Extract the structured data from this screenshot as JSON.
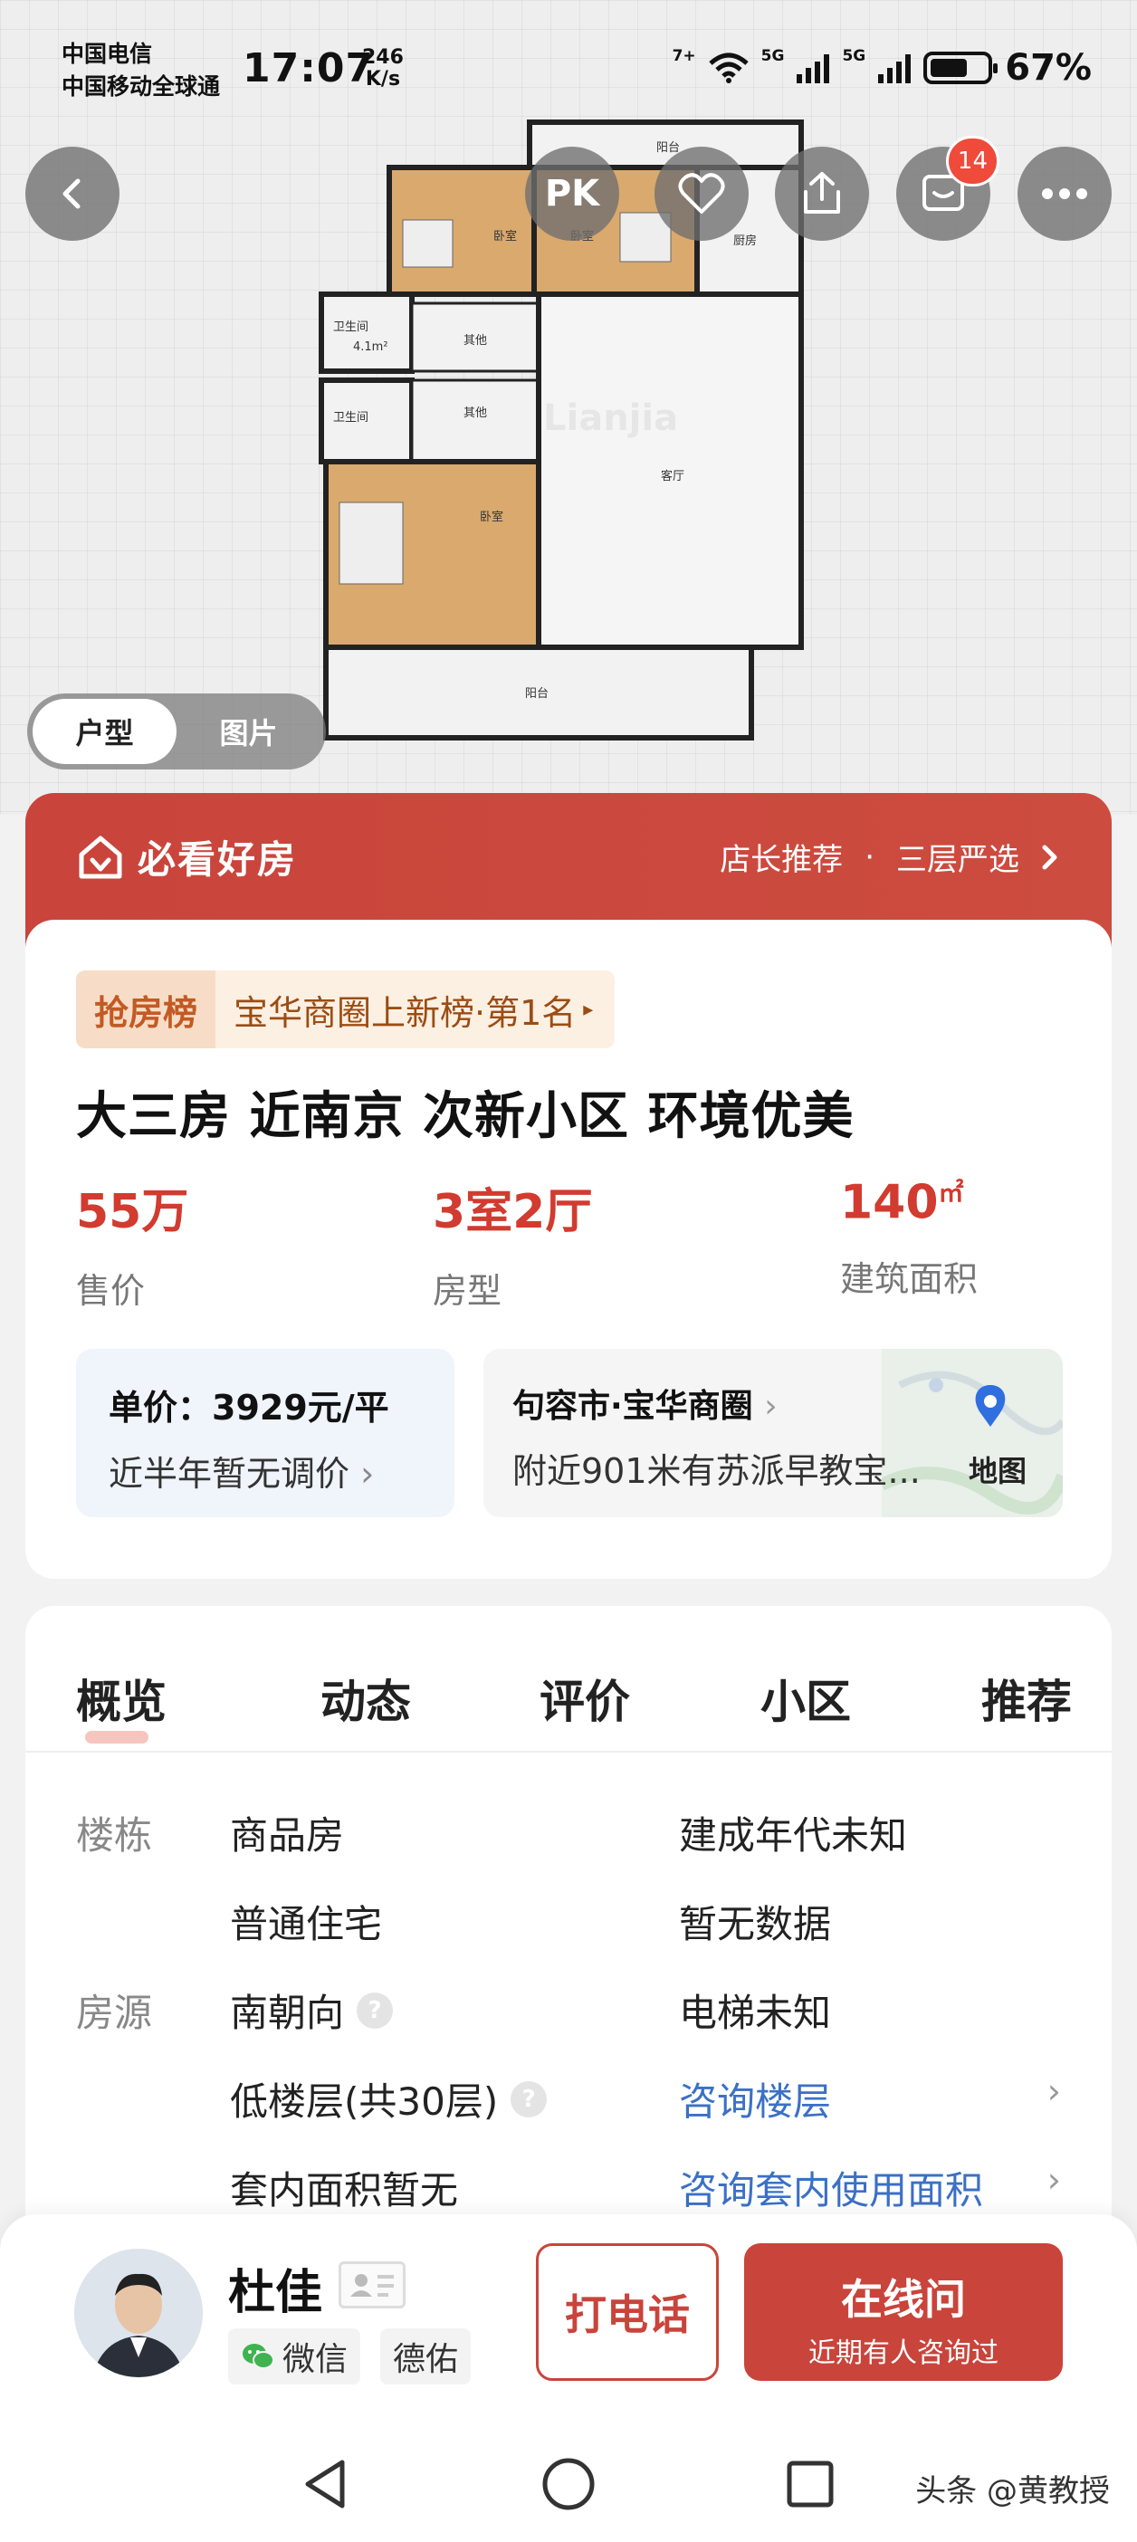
{
  "status": {
    "carrier1": "中国电信",
    "carrier2": "中国移动全球通",
    "time": "17:07",
    "netspeed_value": "246",
    "netspeed_unit": "K/s",
    "wifi_label": "7+",
    "sig1_label": "5G",
    "sig2_label": "5G",
    "battery_pct": "67%",
    "battery_level": 0.67
  },
  "header": {
    "pk_label": "PK",
    "message_badge": "14"
  },
  "floorplan": {
    "rooms": {
      "balcony_top": "阳台",
      "bedroom1": "卧室",
      "bedroom2": "卧室",
      "kitchen": "厨房",
      "bath1": "卫生间",
      "bath1_area": "4.1m²",
      "other1": "其他",
      "bath2": "卫生间",
      "other2": "其他",
      "living": "客厅",
      "bedroom3": "卧室",
      "balcony_bottom": "阳台"
    }
  },
  "view_toggle": {
    "options": [
      "户型",
      "图片"
    ],
    "active": "户型"
  },
  "banner": {
    "brand": "必看好房",
    "item1": "店长推荐",
    "dot": "·",
    "item2": "三层严选"
  },
  "listing": {
    "rank_label": "抢房榜",
    "rank_text": "宝华商圈上新榜·第1名",
    "title": "大三房 近南京 次新小区 环境优美",
    "price_value": "55万",
    "price_label": "售价",
    "layout_value": "3室2厅",
    "layout_label": "房型",
    "area_value": "140",
    "area_unit": "㎡",
    "area_label": "建筑面积",
    "unit_price": "单价：3929元/平",
    "unit_price_note": "近半年暂无调价",
    "location": "句容市·宝华商圈",
    "nearby": "附近901米有苏派早教宝...",
    "map_label": "地图"
  },
  "tabs": [
    "概览",
    "动态",
    "评价",
    "小区",
    "推荐"
  ],
  "details": {
    "cat_building": "楼栋",
    "b1": "商品房",
    "b2": "建成年代未知",
    "b3": "普通住宅",
    "b4": "暂无数据",
    "cat_source": "房源",
    "s1": "南朝向",
    "s2": "电梯未知",
    "s3": "低楼层(共30层)",
    "s4": "咨询楼层",
    "s5": "套内面积暂无",
    "s6": "咨询套内使用面积"
  },
  "agent": {
    "name": "杜佳",
    "chip_wechat": "微信",
    "chip_company": "德佑",
    "call_label": "打电话",
    "chat_label": "在线问",
    "chat_sub": "近期有人咨询过"
  },
  "credit": "头条 @黄教授",
  "colors": {
    "brand_red": "#c9443b",
    "price_red": "#d23b2f",
    "link_blue": "#3b70c6",
    "badge_red": "#ef4a3a"
  }
}
